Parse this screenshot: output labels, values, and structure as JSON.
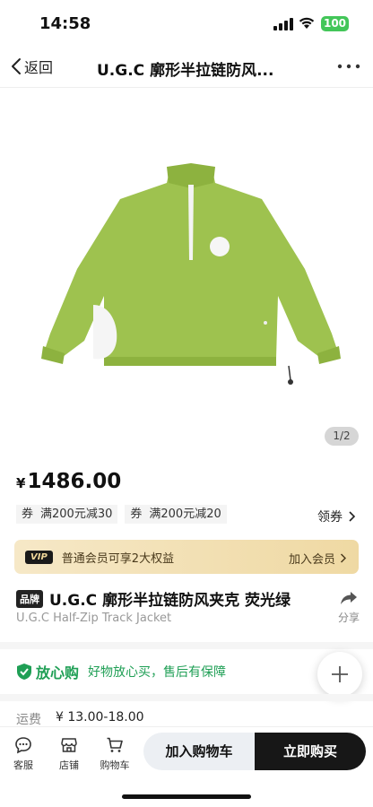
{
  "status_bar": {
    "time": "14:58",
    "battery": "100"
  },
  "nav": {
    "back_label": "返回",
    "title": "U.G.C 廓形半拉链防风..."
  },
  "gallery": {
    "counter": "1/2"
  },
  "price": {
    "symbol": "¥",
    "value": "1486.00"
  },
  "coupons": [
    {
      "tag": "券",
      "text": "满200元减30"
    },
    {
      "tag": "券",
      "text": "满200元减20"
    }
  ],
  "claim_label": "领券",
  "vip": {
    "badge": "VIP",
    "text": "普通会员可享2大权益",
    "join": "加入会员"
  },
  "product": {
    "brand_tag": "品牌",
    "name": "U.G.C 廓形半拉链防风夹克 荧光绿",
    "subtitle": "U.G.C Half-Zip Track Jacket"
  },
  "share_label": "分享",
  "assurance": {
    "title": "放心购",
    "text": "好物放心买，售后有保障"
  },
  "shipping": {
    "label": "运费",
    "value": "¥ 13.00-18.00"
  },
  "bottom_bar": {
    "service": "客服",
    "store": "店铺",
    "cart": "购物车",
    "add_to_cart": "加入购物车",
    "buy_now": "立即购买"
  },
  "colors": {
    "accent_green": "#1f9f55",
    "jacket_green": "#9ec24f",
    "buy_button": "#171717"
  },
  "icons": [
    "chevron-left-icon",
    "more-icon",
    "share-icon",
    "shield-check-icon",
    "plus-icon",
    "chat-icon",
    "store-icon",
    "cart-icon"
  ]
}
